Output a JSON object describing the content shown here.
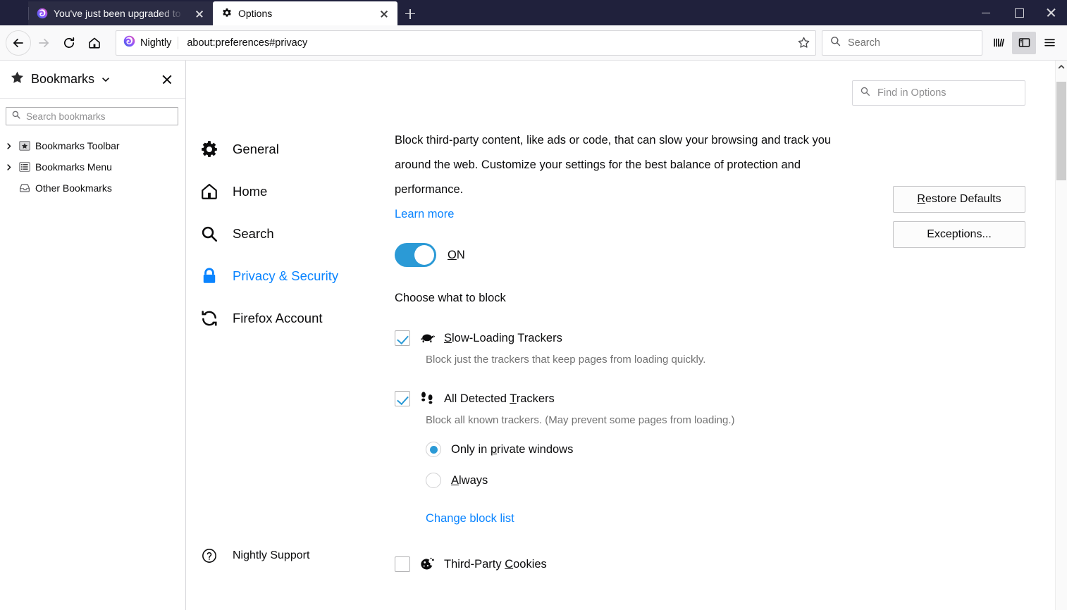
{
  "window": {
    "controls": {
      "minimize": "Minimize",
      "maximize": "Maximize",
      "close": "Close"
    }
  },
  "tabs": [
    {
      "title": "You've just been upgraded to F",
      "favicon": "firefox-nightly-icon",
      "active": false
    },
    {
      "title": "Options",
      "favicon": "gear-icon",
      "active": true
    }
  ],
  "new_tab_label": "New Tab",
  "navbar": {
    "back_label": "Back",
    "forward_label": "Forward",
    "reload_label": "Reload",
    "home_label": "Home",
    "identity_label": "Nightly",
    "url": "about:preferences#privacy",
    "bookmark_label": "Bookmark this page",
    "search_placeholder": "Search",
    "library_label": "Library",
    "sidebar_toggle_label": "Sidebars",
    "menu_label": "Open menu"
  },
  "sidebar": {
    "title": "Bookmarks",
    "close_label": "Close sidebar",
    "search_placeholder": "Search bookmarks",
    "items": [
      {
        "label": "Bookmarks Toolbar",
        "icon": "bookmarks-toolbar-icon",
        "twisty": true
      },
      {
        "label": "Bookmarks Menu",
        "icon": "bookmarks-menu-icon",
        "twisty": true
      },
      {
        "label": "Other Bookmarks",
        "icon": "other-bookmarks-icon",
        "twisty": false
      }
    ]
  },
  "prefs_nav": {
    "items": [
      {
        "label": "General",
        "icon": "gear-icon",
        "selected": false
      },
      {
        "label": "Home",
        "icon": "home-icon",
        "selected": false
      },
      {
        "label": "Search",
        "icon": "magnifier-icon",
        "selected": false
      },
      {
        "label": "Privacy & Security",
        "icon": "lock-icon",
        "selected": true
      },
      {
        "label": "Firefox Account",
        "icon": "sync-icon",
        "selected": false
      }
    ],
    "support": {
      "label": "Nightly Support",
      "icon": "help-circle-icon"
    }
  },
  "main": {
    "find_placeholder": "Find in Options",
    "intro": "Block third-party content, like ads or code, that can slow your browsing and track you around the web. Customize your settings for the best balance of protection and performance.",
    "learn_more": "Learn more",
    "toggle": {
      "state_label": "ON",
      "enabled": true
    },
    "choose_heading": "Choose what to block",
    "options": [
      {
        "label": "Slow-Loading Trackers",
        "icon": "turtle-icon",
        "checked": true,
        "description": "Block just the trackers that keep pages from loading quickly."
      },
      {
        "label": "All Detected Trackers",
        "icon": "footprints-icon",
        "checked": true,
        "description": "Block all known trackers. (May prevent some pages from loading.)",
        "radios": [
          {
            "label": "Only in private windows",
            "selected": true
          },
          {
            "label": "Always",
            "selected": false
          }
        ],
        "link": "Change block list"
      },
      {
        "label": "Third-Party Cookies",
        "icon": "cookie-icon",
        "checked": false
      }
    ],
    "buttons": {
      "restore_defaults": "Restore Defaults",
      "exceptions": "Exceptions..."
    }
  },
  "colors": {
    "accent": "#0a84ff",
    "toggle_on": "#2b9ad6",
    "chrome_dark": "#20213c",
    "link": "#0a84ff"
  }
}
